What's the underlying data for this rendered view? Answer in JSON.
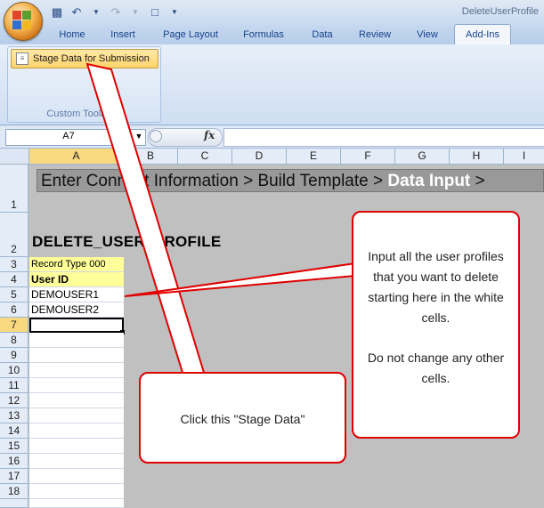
{
  "window": {
    "title": "DeleteUserProfile"
  },
  "qat": {
    "save_icon": "save-icon",
    "undo_icon": "undo-icon",
    "redo_icon": "redo-icon",
    "new_icon": "new-document-icon"
  },
  "ribbon": {
    "tabs": [
      "Home",
      "Insert",
      "Page Layout",
      "Formulas",
      "Data",
      "Review",
      "View",
      "Add-Ins"
    ],
    "active_tab": "Add-Ins",
    "stage_button_label": "Stage Data for Submission",
    "group_label": "Custom Toolbars"
  },
  "formula_bar": {
    "name_box": "A7",
    "fx": "fx",
    "formula": ""
  },
  "grid": {
    "columns": [
      "A",
      "B",
      "C",
      "D",
      "E",
      "F",
      "G",
      "H",
      "I"
    ],
    "rows": [
      "1",
      "2",
      "3",
      "4",
      "5",
      "6",
      "7",
      "8",
      "9",
      "10",
      "11",
      "12",
      "13",
      "14",
      "15",
      "16",
      "17",
      "18"
    ],
    "selected_cell": "A7"
  },
  "sheet": {
    "banner_prefix": "Enter Connect Information > Build Template > ",
    "banner_current": "Data Input",
    "banner_suffix": " >",
    "profile_title": "DELETE_USER_PROFILE",
    "record_type": "Record Type 000",
    "user_id_header": "User ID",
    "user_ids": [
      "DEMOUSER1",
      "DEMOUSER2"
    ]
  },
  "callouts": {
    "input_text_1": "Input all the user profiles that you want to delete starting here in the white cells.",
    "input_text_2": "Do not change any other cells.",
    "stage_text": "Click this \"Stage Data\""
  },
  "colors": {
    "callout_border": "#e00000",
    "selection": "#f8d980",
    "yellow_cell": "#ffff99"
  }
}
